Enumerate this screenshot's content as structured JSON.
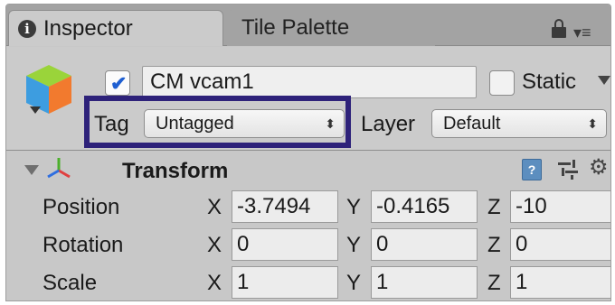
{
  "tabs": [
    {
      "label": "Inspector",
      "icon": "info-icon"
    },
    {
      "label": "Tile Palette"
    }
  ],
  "header": {
    "active": true,
    "object_name": "CM vcam1",
    "static_label": "Static",
    "static_checked": false,
    "tag_label": "Tag",
    "tag_value": "Untagged",
    "layer_label": "Layer",
    "layer_value": "Default",
    "highlight_color": "#2e227a"
  },
  "transform": {
    "title": "Transform",
    "rows": [
      {
        "label": "Position",
        "x": "-3.7494",
        "y": "-0.4165",
        "z": "-10"
      },
      {
        "label": "Rotation",
        "x": "0",
        "y": "0",
        "z": "0"
      },
      {
        "label": "Scale",
        "x": "1",
        "y": "1",
        "z": "1"
      }
    ],
    "axis_labels": {
      "x": "X",
      "y": "Y",
      "z": "Z"
    },
    "help_glyph": "?"
  },
  "icons": {
    "info": "i",
    "menu": "▾≡",
    "gear": "⚙",
    "dropdown_arrows": "⬍"
  }
}
